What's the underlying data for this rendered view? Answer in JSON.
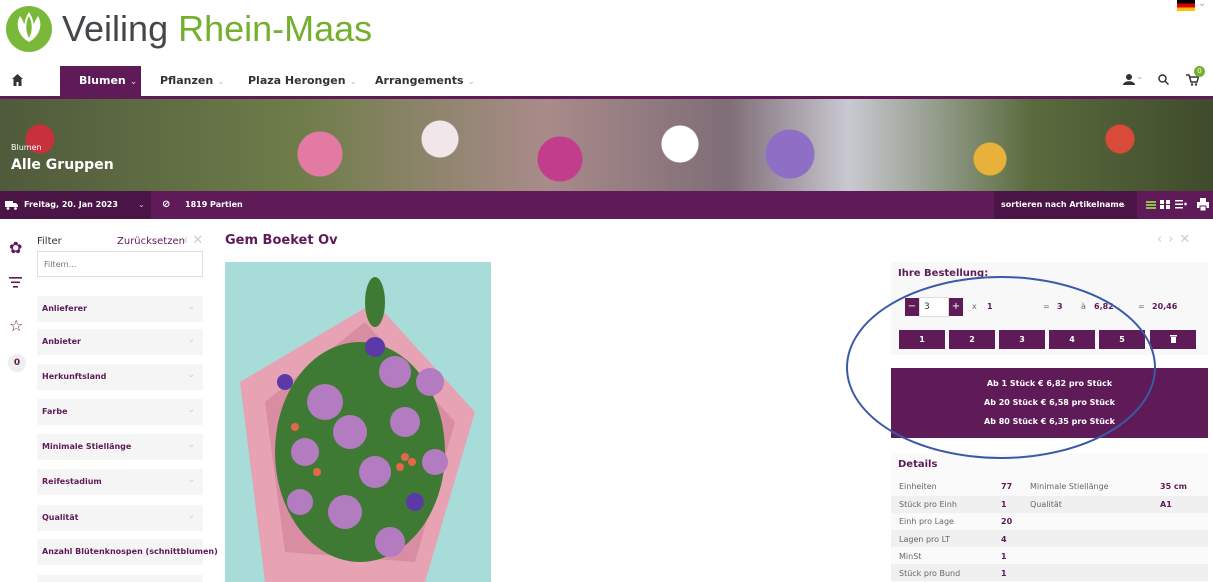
{
  "header": {
    "brand_part1": "Veiling ",
    "brand_part2": "Rhein-Maas"
  },
  "nav": {
    "items": [
      "Blumen",
      "Pflanzen",
      "Plaza Herongen",
      "Arrangements"
    ],
    "cart_count": "0"
  },
  "banner": {
    "subtitle": "Blumen",
    "title": "Alle Gruppen"
  },
  "toolbar": {
    "date": "Freitag, 20. Jan 2023",
    "partien": "1819 Partien",
    "sort": "sortieren nach Artikelname"
  },
  "filter": {
    "label": "Filter",
    "reset": "Zurücksetzen",
    "placeholder": "Filtern...",
    "items": [
      "Anlieferer",
      "Anbieter",
      "Herkunftsland",
      "Farbe",
      "Minimale Stiellänge",
      "Reifestadium",
      "Qualität",
      "Anzahl Blütenknospen (schnittblumen)"
    ]
  },
  "sidebar": {
    "badge": "0"
  },
  "product": {
    "title": "Gem Boeket Ov"
  },
  "order": {
    "title": "Ihre Bestellung:",
    "quantity": "3",
    "times": "x",
    "multiplier": "1",
    "equals1": "=",
    "total_units": "3",
    "at": "à",
    "unit_price": "6,82",
    "equals2": "=",
    "total_price": "20,46",
    "quick_buttons": [
      "1",
      "2",
      "3",
      "4",
      "5"
    ]
  },
  "pricing": {
    "lines": [
      "Ab 1 Stück € 6,82 pro Stück",
      "Ab 20 Stück € 6,58 pro Stück",
      "Ab 80 Stück € 6,35 pro Stück"
    ]
  },
  "details": {
    "title": "Details",
    "left": [
      {
        "label": "Einheiten",
        "value": "77"
      },
      {
        "label": "Stück pro Einh",
        "value": "1"
      },
      {
        "label": "Einh pro Lage",
        "value": "20"
      },
      {
        "label": "Lagen pro LT",
        "value": "4"
      },
      {
        "label": "MinSt",
        "value": "1"
      },
      {
        "label": "Stück pro Bund",
        "value": "1"
      }
    ],
    "right": [
      {
        "label": "Minimale Stiellänge",
        "value": "35 cm"
      },
      {
        "label": "Qualität",
        "value": "A1"
      }
    ]
  },
  "colors": {
    "brand_purple": "#5e1b57",
    "brand_green": "#74b02e",
    "annotation_blue": "#3a5aa8"
  }
}
